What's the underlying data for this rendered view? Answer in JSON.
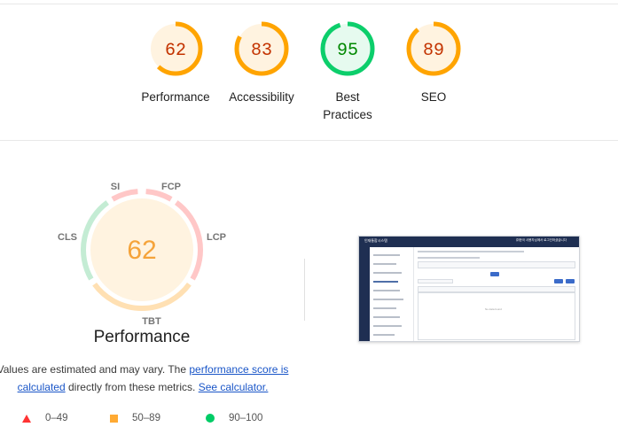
{
  "categories": [
    {
      "id": "performance",
      "label": "Performance",
      "score": "62",
      "fraction": 0.62,
      "color": "#ffa400",
      "fill": "#fff3e0",
      "text": "#c33300"
    },
    {
      "id": "accessibility",
      "label": "Accessibility",
      "score": "83",
      "fraction": 0.83,
      "color": "#ffa400",
      "fill": "#fff3e0",
      "text": "#c33300"
    },
    {
      "id": "best-practices",
      "label": "Best Practices",
      "label_line1": "Best",
      "label_line2": "Practices",
      "score": "95",
      "fraction": 0.95,
      "color": "#0cce6b",
      "fill": "#e6faef",
      "text": "#008800"
    },
    {
      "id": "seo",
      "label": "SEO",
      "score": "89",
      "fraction": 0.89,
      "color": "#ffa400",
      "fill": "#fff3e0",
      "text": "#c33300"
    }
  ],
  "performance_gauge": {
    "score": "62",
    "title": "Performance",
    "metrics": {
      "si": "SI",
      "fcp": "FCP",
      "lcp": "LCP",
      "tbt": "TBT",
      "cls": "CLS"
    },
    "colors": {
      "si": "#ffc7c7",
      "fcp": "#ffc7c7",
      "lcp": "#ffc7c7",
      "tbt": "#ffe0b3",
      "cls": "#c4ecd4",
      "center_fill": "#fff3e0",
      "score_text": "#f5a33a"
    }
  },
  "description": {
    "text_before": "Values are estimated and may vary. The ",
    "link1": "performance score is calculated",
    "text_middle": " directly from these metrics. ",
    "link2": "See calculator."
  },
  "legend": [
    {
      "id": "fail",
      "range": "0–49",
      "color": "#ff3333"
    },
    {
      "id": "average",
      "range": "50–89",
      "color": "#ffaa33"
    },
    {
      "id": "pass",
      "range": "90–100",
      "color": "#00cc66"
    }
  ],
  "thumbnail": {
    "brand": "인재통합시스템",
    "user_info": "㈜한국 사용자님께서 로그인하셨습니다",
    "empty_text": "No data found"
  }
}
